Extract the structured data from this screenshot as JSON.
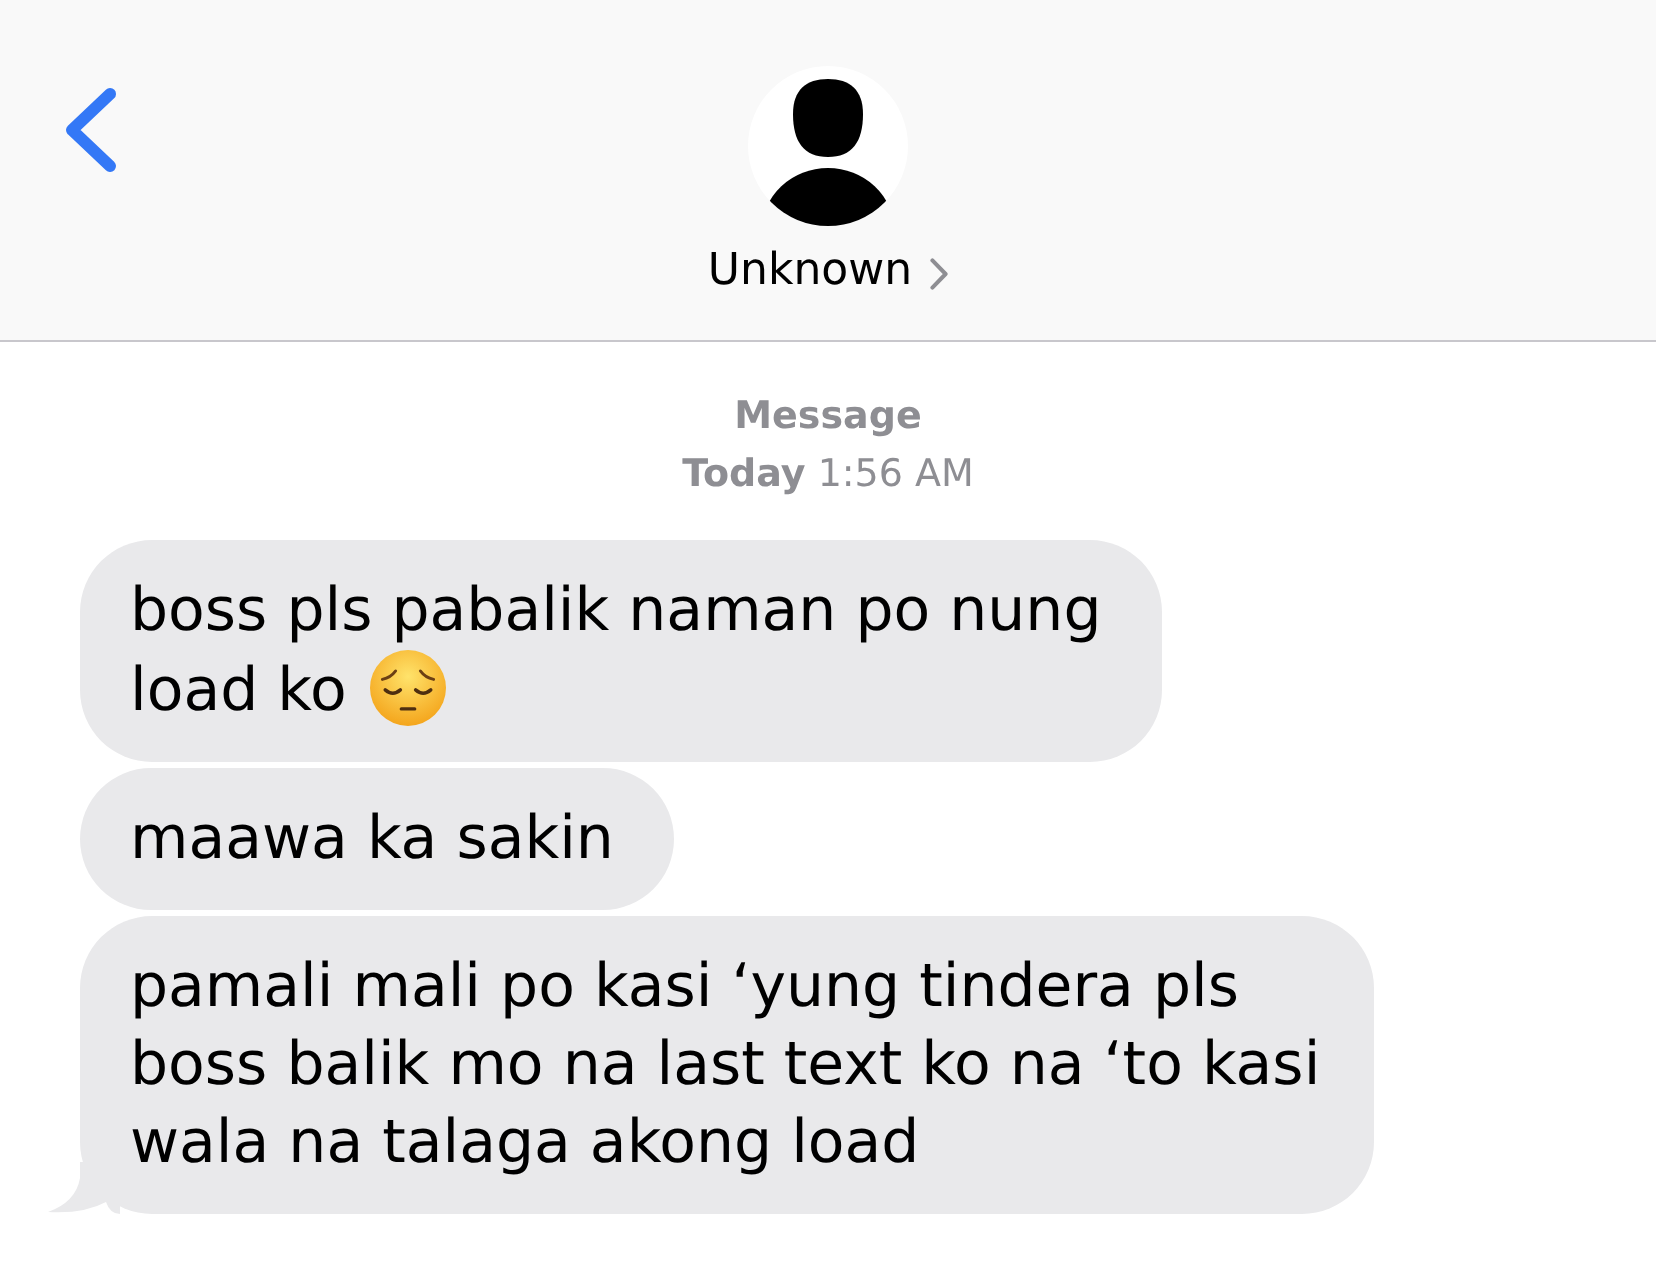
{
  "header": {
    "contact_name": "Unknown"
  },
  "thread": {
    "service_label": "Message",
    "timestamp": "**Today** 1:56 AM"
  },
  "messages": [
    {
      "lines": [
        "boss pls pabalik naman po nung",
        "load ko"
      ],
      "trailing_emoji": true,
      "tail": false
    },
    {
      "lines": [
        "maawa ka sakin"
      ],
      "trailing_emoji": false,
      "tail": false
    },
    {
      "lines": [
        "pamali mali po kasi ‘yung tindera pls",
        "boss balik mo na last text ko na ‘to kasi",
        "wala na talaga akong load"
      ],
      "trailing_emoji": false,
      "tail": true
    }
  ]
}
